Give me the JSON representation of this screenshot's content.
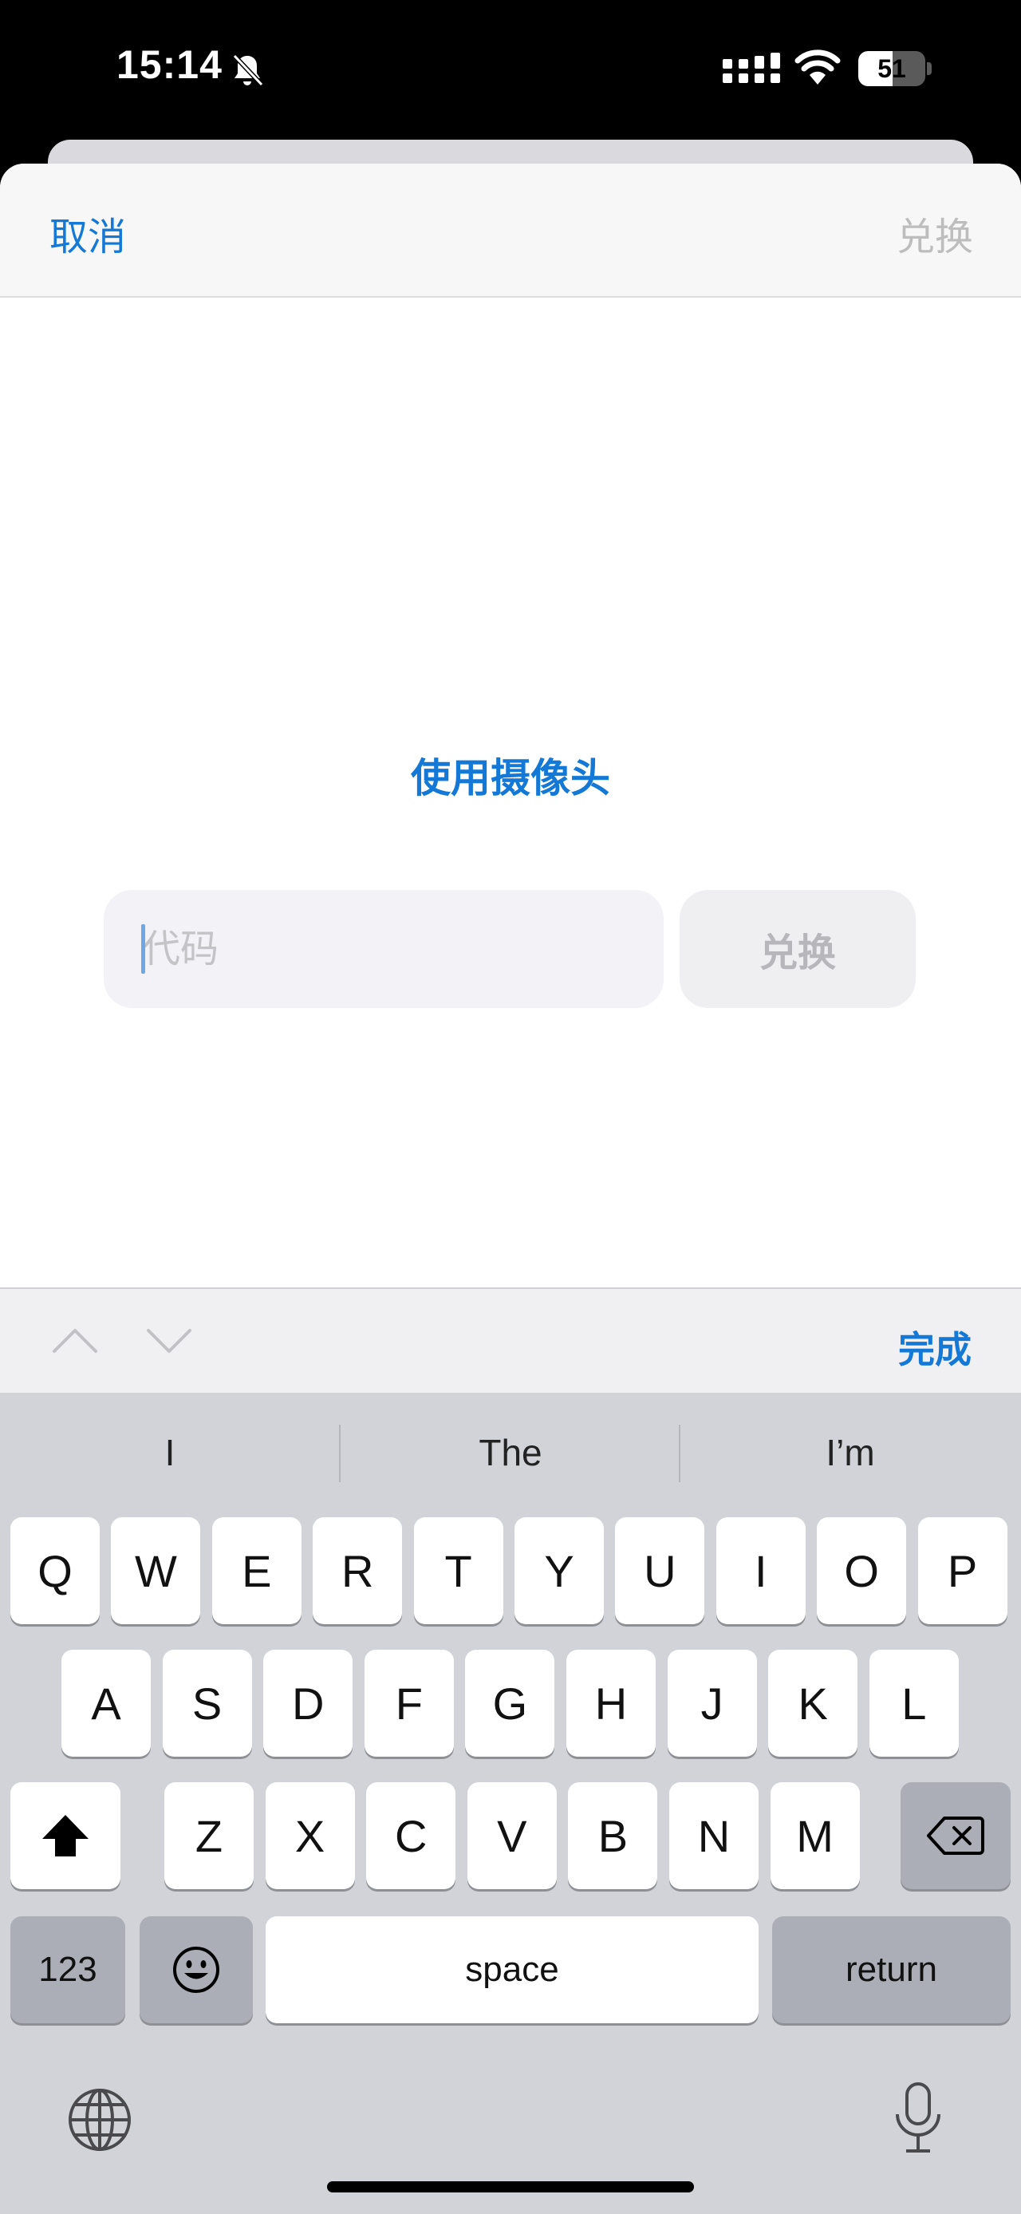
{
  "status_bar": {
    "time": "15:14",
    "battery": "51",
    "battery_level_percent": 51,
    "icons": [
      "bell-slash-icon",
      "cellular-signal-icon",
      "wifi-icon",
      "battery-icon"
    ]
  },
  "nav": {
    "cancel_label": "取消",
    "redeem_label": "兑换"
  },
  "main": {
    "camera_label": "使用摄像头",
    "code_placeholder": "代码",
    "code_value": "",
    "redeem_button_label": "兑换"
  },
  "toolbar": {
    "done_label": "完成",
    "icons": [
      "chevron-up-icon",
      "chevron-down-icon"
    ]
  },
  "keyboard": {
    "suggestions": [
      "I",
      "The",
      "I’m"
    ],
    "row1": [
      "Q",
      "W",
      "E",
      "R",
      "T",
      "Y",
      "U",
      "I",
      "O",
      "P"
    ],
    "row2": [
      "A",
      "S",
      "D",
      "F",
      "G",
      "H",
      "J",
      "K",
      "L"
    ],
    "row3": [
      "Z",
      "X",
      "C",
      "V",
      "B",
      "N",
      "M"
    ],
    "numbers_label": "123",
    "space_label": "space",
    "return_label": "return",
    "icons": [
      "shift-icon",
      "delete-icon",
      "emoji-icon",
      "globe-icon",
      "microphone-icon"
    ]
  },
  "colors": {
    "accent": "#1479d6",
    "disabled": "#bdbdbd",
    "keyboard_bg": "#d1d3d9"
  }
}
